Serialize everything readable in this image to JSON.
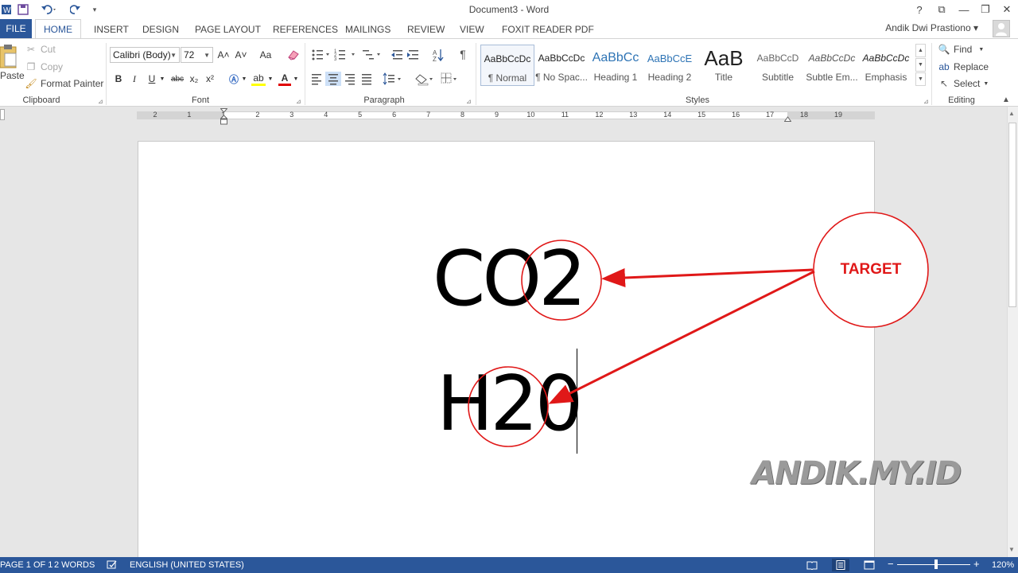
{
  "titlebar": {
    "title": "Document3 - Word",
    "help": "?",
    "ribbon_options": "⧉",
    "minimize": "—",
    "restore": "❐",
    "close": "✕"
  },
  "tabs": {
    "file": "FILE",
    "items": [
      "HOME",
      "INSERT",
      "DESIGN",
      "PAGE LAYOUT",
      "REFERENCES",
      "MAILINGS",
      "REVIEW",
      "VIEW",
      "FOXIT READER PDF"
    ],
    "active": "HOME",
    "user": "Andik Dwi Prastiono ▾"
  },
  "clipboard": {
    "paste": "Paste",
    "cut": "Cut",
    "copy": "Copy",
    "format_painter": "Format Painter",
    "label": "Clipboard"
  },
  "font": {
    "name": "Calibri (Body)",
    "size": "72",
    "label": "Font",
    "bold": "B",
    "italic": "I",
    "underline": "U",
    "strike": "abc",
    "subscript": "x₂",
    "superscript": "x²",
    "grow": "A˄",
    "shrink": "A˅",
    "change_case": "Aa",
    "font_color": "A",
    "highlight": "ab"
  },
  "paragraph": {
    "label": "Paragraph",
    "pilcrow": "¶"
  },
  "styles": {
    "label": "Styles",
    "items": [
      {
        "preview": "AaBbCcDc",
        "name": "¶ Normal"
      },
      {
        "preview": "AaBbCcDc",
        "name": "¶ No Spac..."
      },
      {
        "preview": "AaBbCc",
        "name": "Heading 1"
      },
      {
        "preview": "AaBbCcE",
        "name": "Heading 2"
      },
      {
        "preview": "AaB",
        "name": "Title"
      },
      {
        "preview": "AaBbCcD",
        "name": "Subtitle"
      },
      {
        "preview": "AaBbCcDc",
        "name": "Subtle Em..."
      },
      {
        "preview": "AaBbCcDc",
        "name": "Emphasis"
      }
    ]
  },
  "editing": {
    "label": "Editing",
    "find": "Find",
    "replace": "Replace",
    "select": "Select"
  },
  "ruler": {
    "ticks": [
      "2",
      "1",
      "1",
      "2",
      "3",
      "4",
      "5",
      "6",
      "7",
      "8",
      "9",
      "10",
      "11",
      "12",
      "13",
      "14",
      "15",
      "16",
      "17",
      "18",
      "19"
    ]
  },
  "document": {
    "line1": "CO2",
    "line2": "H20"
  },
  "annotations": {
    "target_label": "TARGET",
    "color": "#e01818"
  },
  "watermark": "ANDIK.MY.ID",
  "statusbar": {
    "page": "PAGE 1 OF 1",
    "words": "2 WORDS",
    "language": "ENGLISH (UNITED STATES)",
    "zoom_minus": "−",
    "zoom_plus": "+",
    "zoom": "120%",
    "zoom_level": 120
  },
  "colors": {
    "accent": "#2b579a",
    "status_bar": "#2b579a",
    "annotation_red": "#e01818"
  }
}
